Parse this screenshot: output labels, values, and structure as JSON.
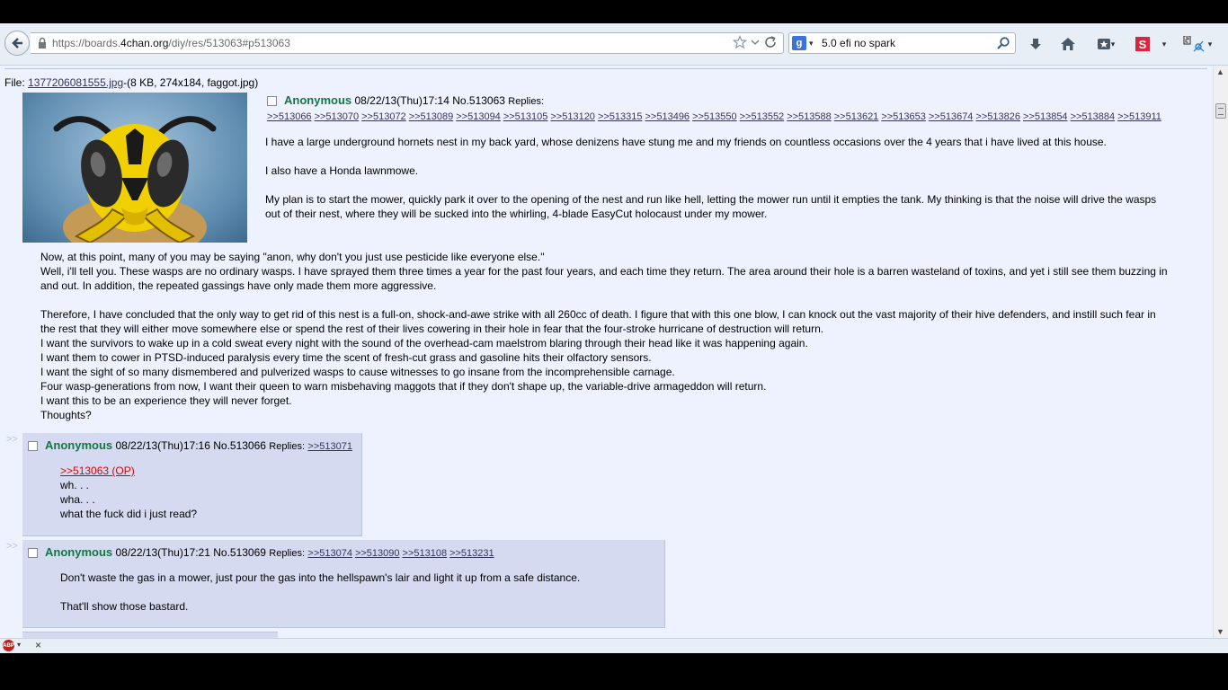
{
  "browser": {
    "url_prefix": "https://boards.",
    "url_domain": "4chan.org",
    "url_suffix": "/diy/res/513063#p513063",
    "search_query": "5.0 efi no spark",
    "search_engine_letter": "g",
    "stumble_letter": "S",
    "abp_label": "ABP",
    "close_label": "×"
  },
  "op": {
    "file_label": "File: ",
    "file_name": "1377206081555.jpg",
    "file_meta": "-(8 KB, 274x184, faggot.jpg)",
    "name": "Anonymous",
    "datetime": "08/22/13(Thu)17:14",
    "post_no": "No.513063",
    "replies_label": "Replies:",
    "replies": [
      ">>513066",
      ">>513070",
      ">>513072",
      ">>513089",
      ">>513094",
      ">>513105",
      ">>513120",
      ">>513315",
      ">>513496",
      ">>513550",
      ">>513552",
      ">>513588",
      ">>513621",
      ">>513653",
      ">>513674",
      ">>513826",
      ">>513854",
      ">>513884",
      ">>513911"
    ],
    "para1": "I have a large underground hornets nest in my back yard, whose denizens have stung me and my friends on countless occasions over the 4 years that i have lived at this house.",
    "para2": "I also have a Honda lawnmowe.",
    "para3": "My plan is to start the mower, quickly park it over to the opening of the nest and run like hell, letting the mower run until it empties the tank. My thinking is that the noise will drive the wasps out of their nest, where they will be sucked into the whirling, 4-blade EasyCut holocaust under my mower.",
    "para4_l1": "Now, at this point, many of you may be saying \"anon, why don't you just use pesticide like everyone else.\"",
    "para4_l2": "Well, i'll tell you. These wasps are no ordinary wasps. I have sprayed them three times a year for the past four years, and each time they return. The area around their hole is a barren wasteland of toxins, and yet i still see them buzzing in and out. In addition, the repeated gassings have only made them more aggressive.",
    "para5_l1": "Therefore, I have concluded that the only way to get rid of this nest is a full-on, shock-and-awe strike with all 260cc of death. I figure that with this one blow, I can knock out the vast majority of their hive defenders, and instill such fear in the rest that they will either move somewhere else or spend the rest of their lives cowering in their hole in fear that the four-stroke hurricane of destruction will return.",
    "para5_l2": "I want the survivors to wake up in a cold sweat every night with the sound of the overhead-cam maelstrom blaring through their head like it was happening again.",
    "para5_l3": "I want them to cower in PTSD-induced paralysis every time the scent of fresh-cut grass and gasoline hits their olfactory sensors.",
    "para5_l4": "I want the sight of so many dismembered and pulverized wasps to cause witnesses to go insane from the incomprehensible carnage.",
    "para5_l5": "Four wasp-generations from now, I want their queen to warn misbehaving maggots that if they don't shape up, the variable-drive armageddon will return.",
    "para5_l6": "I want this to be an experience they will never forget.",
    "para5_l7": "Thoughts?"
  },
  "replies": [
    {
      "arrow": ">>",
      "name": "Anonymous",
      "datetime": "08/22/13(Thu)17:16",
      "post_no": "No.513066",
      "replies_label": "Replies:",
      "backlinks": [
        ">>513071"
      ],
      "quote": ">>513063 (OP)",
      "l1": "wh. . .",
      "l2": "wha. . .",
      "l3": "what the fuck did i just read?"
    },
    {
      "arrow": ">>",
      "name": "Anonymous",
      "datetime": "08/22/13(Thu)17:21",
      "post_no": "No.513069",
      "replies_label": "Replies:",
      "backlinks": [
        ">>513074",
        ">>513090",
        ">>513108",
        ">>513231"
      ],
      "p1": "Don't waste the gas in a mower, just pour the gas into the hellspawn's lair and light it up from a safe distance.",
      "p2": "That'll show those bastard."
    }
  ],
  "colors": {
    "page_bg": "#eef2ff",
    "reply_bg": "#d6daf0",
    "name_green": "#117743",
    "link": "#34345c",
    "op_quote_red": "#dd0000"
  }
}
